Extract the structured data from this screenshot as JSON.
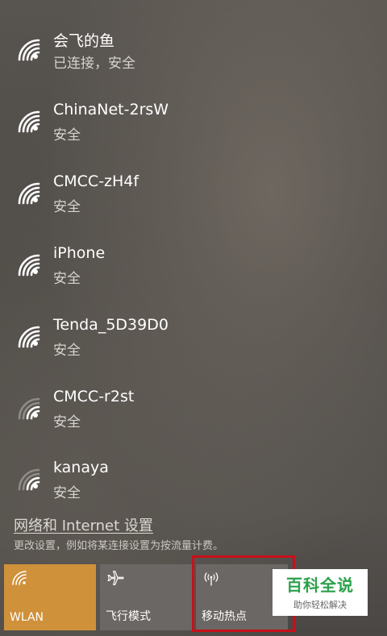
{
  "networks": [
    {
      "name": "会飞的鱼",
      "status": "已连接，安全",
      "signal": "full"
    },
    {
      "name": "ChinaNet-2rsW",
      "status": "安全",
      "signal": "full"
    },
    {
      "name": "CMCC-zH4f",
      "status": "安全",
      "signal": "full"
    },
    {
      "name": "iPhone",
      "status": "安全",
      "signal": "full"
    },
    {
      "name": "Tenda_5D39D0",
      "status": "安全",
      "signal": "full"
    },
    {
      "name": "CMCC-r2st",
      "status": "安全",
      "signal": "weak"
    },
    {
      "name": "kanaya",
      "status": "安全",
      "signal": "weak"
    }
  ],
  "settings": {
    "link_label": "网络和 Internet 设置",
    "description": "更改设置，例如将某连接设置为按流量计费。"
  },
  "quick_actions": [
    {
      "label": "WLAN",
      "icon": "wifi-icon",
      "active": true,
      "color": "#d0913b"
    },
    {
      "label": "飞行模式",
      "icon": "airplane-icon",
      "active": false
    },
    {
      "label": "移动热点",
      "icon": "hotspot-icon",
      "active": false
    }
  ],
  "highlight_color": "#c8101a",
  "watermark": {
    "title": "百科全说",
    "subtitle": "助你轻松解决",
    "color": "#2aa04a"
  }
}
